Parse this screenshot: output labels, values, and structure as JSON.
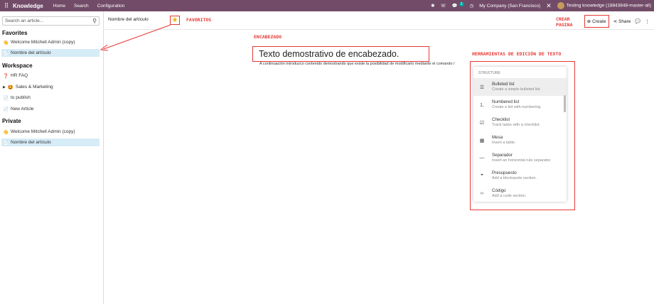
{
  "topbar": {
    "app_name": "Knowledge",
    "menu": [
      "Home",
      "Search",
      "Configuration"
    ],
    "chat_badge": "2",
    "company": "My Company (San Francisco)",
    "database": "Testing knowledge (18843848-master-all)"
  },
  "sidebar": {
    "search_placeholder": "Search an article...",
    "favorites_label": "Favorites",
    "favorites": [
      {
        "label": "Welcome Mitchell Admin (copy)",
        "icon": "👋"
      },
      {
        "label": "Nombre del artículo",
        "icon": "📄"
      }
    ],
    "workspace_label": "Workspace",
    "workspace": [
      {
        "label": "HR FAQ",
        "icon": "❓"
      },
      {
        "label": "Sales & Marketing",
        "icon": "🤩"
      },
      {
        "label": "to publish",
        "icon": "📄"
      },
      {
        "label": "New Article",
        "icon": "📄"
      }
    ],
    "private_label": "Private",
    "private": [
      {
        "label": "Welcome Mitchell Admin (copy)",
        "icon": "👋"
      },
      {
        "label": "Nombre del artículo",
        "icon": "📄"
      }
    ]
  },
  "header": {
    "breadcrumb": "Nombre del artículo",
    "create_label": "Create",
    "share_label": "Share"
  },
  "annotations": {
    "favoritos": "FAVORITOS",
    "crear_pagina": "CREAR\nPAGINA",
    "encabezado": "ENCABEZADO",
    "herramientas": "HERRAMIENTAS DE EDICIÓN DE TEXTO"
  },
  "editor": {
    "title": "Texto demostrativo de encabezado.",
    "paragraph": "A continuación introduzco contenido demostrando que existe la posibilidad de modificarlo mediante el comando /"
  },
  "commands": {
    "section": "STRUCTURE",
    "items": [
      {
        "title": "Bulleted list",
        "desc": "Create a simple bulleted list.",
        "icon": "☰"
      },
      {
        "title": "Numbered list",
        "desc": "Create a list with numbering.",
        "icon": "⒈"
      },
      {
        "title": "Checklist",
        "desc": "Track tasks with a checklist.",
        "icon": "☑"
      },
      {
        "title": "Mesa",
        "desc": "Insert a table.",
        "icon": "▦"
      },
      {
        "title": "Separador",
        "desc": "Insert an horizontal rule separator.",
        "icon": "—"
      },
      {
        "title": "Presupuesto",
        "desc": "Add a blockquote section.",
        "icon": "❞"
      },
      {
        "title": "Código",
        "desc": "Add a code section.",
        "icon": "‹›"
      }
    ]
  },
  "colors": {
    "brand": "#714b67",
    "annotation": "#e53935",
    "selected": "#d6ecf7"
  }
}
